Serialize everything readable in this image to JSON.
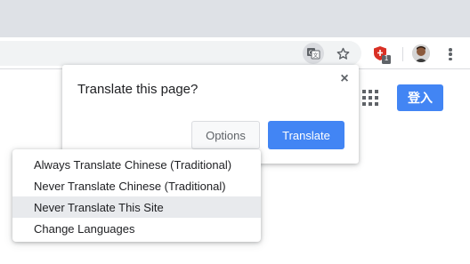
{
  "toolbar": {
    "translate_icon": "translate-icon",
    "bookmark_icon": "star-icon",
    "extension_icon": "shield-extension-icon",
    "extension_badge": "1",
    "menu_icon": "more-vert-icon"
  },
  "page": {
    "apps_icon": "apps-grid-icon",
    "signin_label": "登入"
  },
  "bubble": {
    "title": "Translate this page?",
    "close_icon": "×",
    "options_label": "Options",
    "translate_label": "Translate"
  },
  "options_menu": {
    "items": [
      {
        "label": "Always Translate Chinese (Traditional)",
        "highlighted": false
      },
      {
        "label": "Never Translate Chinese (Traditional)",
        "highlighted": false
      },
      {
        "label": "Never Translate This Site",
        "highlighted": true
      },
      {
        "label": "Change Languages",
        "highlighted": false
      }
    ]
  },
  "colors": {
    "accent": "#4285f4",
    "tabstrip": "#dee1e6",
    "omnibox": "#f1f3f4",
    "extension_red": "#d93025"
  }
}
